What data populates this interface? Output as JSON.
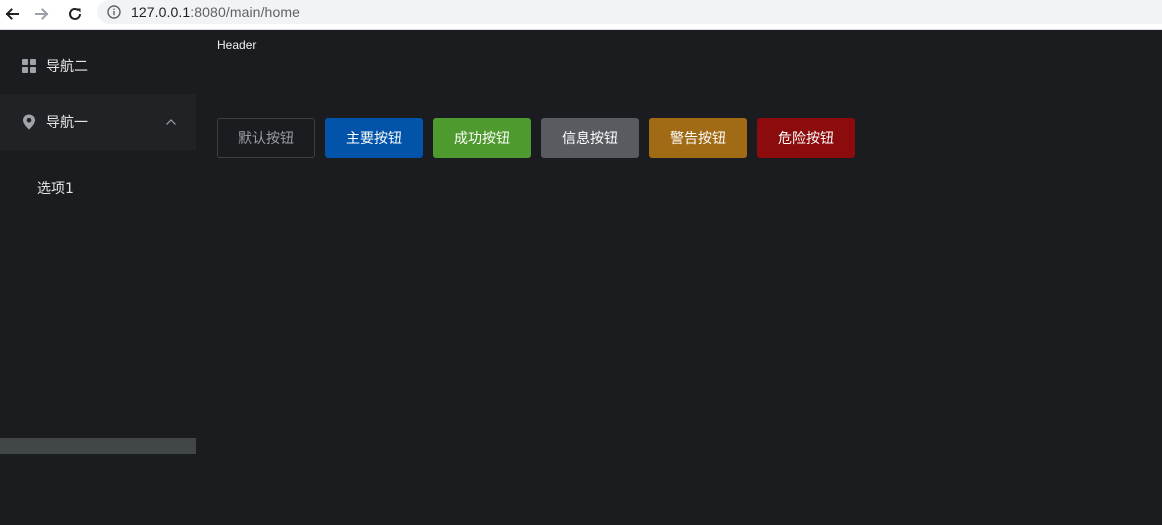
{
  "browser": {
    "url_host": "127.0.0.1",
    "url_rest": ":8080/main/home"
  },
  "header": {
    "title": "Header"
  },
  "sidebar": {
    "items": [
      {
        "label": "导航二",
        "icon": "grid-icon"
      },
      {
        "label": "导航一",
        "icon": "location-icon",
        "expanded": true
      }
    ],
    "submenu": [
      {
        "label": "选项1"
      }
    ]
  },
  "buttons": {
    "default": "默认按钮",
    "primary": "主要按钮",
    "success": "成功按钮",
    "info": "信息按钮",
    "warning": "警告按钮",
    "danger": "危险按钮"
  },
  "colors": {
    "background": "#1b1c1f",
    "primary": "#0154a9",
    "success": "#4e9a2e",
    "info": "#585c61",
    "warning": "#a16a15",
    "danger": "#8c0b0d"
  }
}
